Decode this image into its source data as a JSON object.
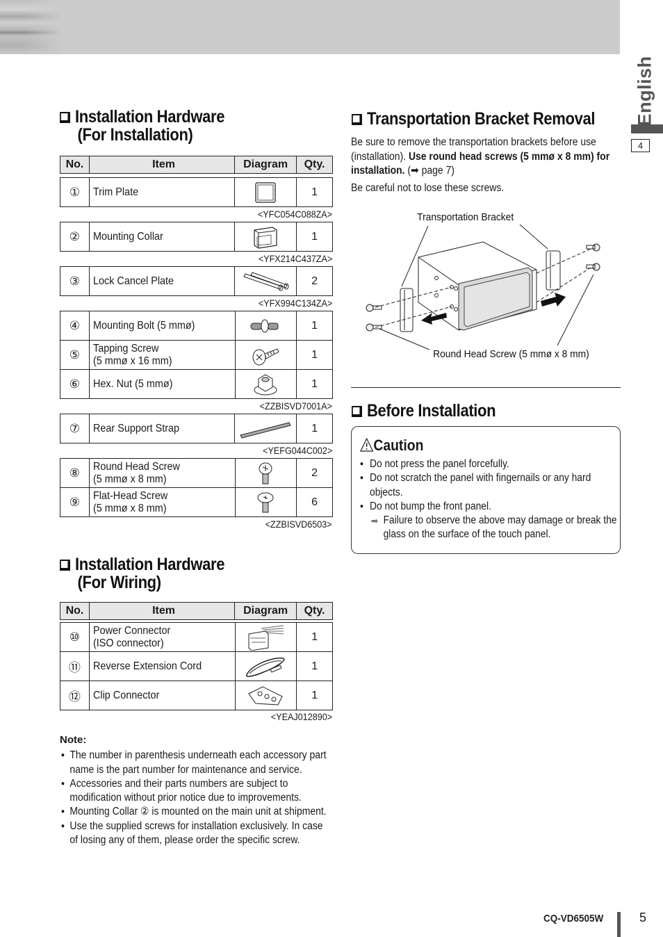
{
  "header": {
    "language_tab": "English",
    "language_page": "4"
  },
  "install_hw": {
    "title_line1": "Installation Hardware",
    "title_line2": "(For Installation)",
    "columns": {
      "no": "No.",
      "item": "Item",
      "diagram": "Diagram",
      "qty": "Qty."
    },
    "groups": [
      {
        "part_no": "<YFC054C088ZA>",
        "rows": [
          {
            "no": "①",
            "item": "Trim Plate",
            "item2": "",
            "qty": "1",
            "icon": "trim-plate-icon"
          }
        ]
      },
      {
        "part_no": "<YFX214C437ZA>",
        "rows": [
          {
            "no": "②",
            "item": "Mounting Collar",
            "item2": "",
            "qty": "1",
            "icon": "mounting-collar-icon"
          }
        ]
      },
      {
        "part_no": "<YFX994C134ZA>",
        "rows": [
          {
            "no": "③",
            "item": "Lock Cancel Plate",
            "item2": "",
            "qty": "2",
            "icon": "lock-cancel-plate-icon"
          }
        ]
      },
      {
        "part_no": "<ZZBISVD7001A>",
        "rows": [
          {
            "no": "④",
            "item": "Mounting Bolt (5 mmø)",
            "item2": "",
            "qty": "1",
            "icon": "mounting-bolt-icon"
          },
          {
            "no": "⑤",
            "item": "Tapping Screw",
            "item2": "(5 mmø x 16 mm)",
            "qty": "1",
            "icon": "tapping-screw-icon"
          },
          {
            "no": "⑥",
            "item": "Hex. Nut (5 mmø)",
            "item2": "",
            "qty": "1",
            "icon": "hex-nut-icon"
          }
        ]
      },
      {
        "part_no": "<YEFG044C002>",
        "rows": [
          {
            "no": "⑦",
            "item": "Rear Support Strap",
            "item2": "",
            "qty": "1",
            "icon": "rear-support-strap-icon"
          }
        ]
      },
      {
        "part_no": "<ZZBISVD6503>",
        "rows": [
          {
            "no": "⑧",
            "item": "Round Head Screw",
            "item2": "(5 mmø x 8 mm)",
            "qty": "2",
            "icon": "round-head-screw-icon"
          },
          {
            "no": "⑨",
            "item": "Flat-Head Screw",
            "item2": "(5 mmø x 8 mm)",
            "qty": "6",
            "icon": "flat-head-screw-icon"
          }
        ]
      }
    ]
  },
  "wiring_hw": {
    "title_line1": "Installation Hardware",
    "title_line2": "(For Wiring)",
    "columns": {
      "no": "No.",
      "item": "Item",
      "diagram": "Diagram",
      "qty": "Qty."
    },
    "part_no": "<YEAJ012890>",
    "rows": [
      {
        "no": "⑩",
        "item": "Power Connector",
        "item2": "(ISO connector)",
        "qty": "1",
        "icon": "power-connector-icon"
      },
      {
        "no": "⑪",
        "item": "Reverse Extension Cord",
        "item2": "",
        "qty": "1",
        "icon": "extension-cord-icon"
      },
      {
        "no": "⑫",
        "item": "Clip Connector",
        "item2": "",
        "qty": "1",
        "icon": "clip-connector-icon"
      }
    ]
  },
  "note": {
    "title": "Note:",
    "items": [
      "The number in parenthesis underneath each accessory part name is the part number for maintenance and service.",
      "Accessories and their parts numbers are subject to modification without prior notice due to improvements.",
      "Mounting Collar ② is mounted on the main unit at shipment.",
      "Use the supplied screws for installation exclusively. In case of losing any of them, please order the specific screw."
    ]
  },
  "bracket": {
    "title": "Transportation Bracket Removal",
    "para1_a": "Be sure to remove the transportation brackets before use (installation). ",
    "para1_bold": "Use round head screws (5 mmø x 8 mm) for installation.",
    "para1_ref": " (➡ page 7)",
    "para2": "Be careful not to lose these screws.",
    "figure_label_top": "Transportation Bracket",
    "figure_label_bottom": "Round Head Screw (5 mmø x 8 mm)"
  },
  "before": {
    "title": "Before Installation",
    "caution_title": "Caution",
    "items": [
      "Do not press the panel forcefully.",
      "Do not scratch the panel with fingernails or any hard objects.",
      "Do not bump the front panel."
    ],
    "consequence": "Failure to observe the above may damage or break the glass on the surface of the touch panel."
  },
  "footer": {
    "model": "CQ-VD6505W",
    "page": "5"
  }
}
